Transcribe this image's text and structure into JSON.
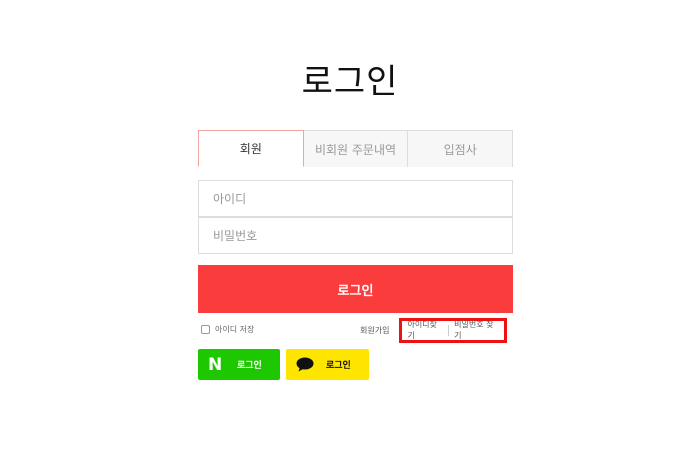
{
  "page": {
    "title": "로그인"
  },
  "tabs": [
    {
      "label": "회원",
      "active": true
    },
    {
      "label": "비회원 주문내역",
      "active": false
    },
    {
      "label": "입점사",
      "active": false
    }
  ],
  "form": {
    "id_placeholder": "아이디",
    "pw_placeholder": "비밀번호",
    "login_label": "로그인"
  },
  "options": {
    "save_id_label": "아이디 저장",
    "join_label": "회원가입",
    "find_id_label": "아이디찾기",
    "find_pw_label": "비밀번호 찾기"
  },
  "social": {
    "naver": {
      "logo": "N",
      "label": "로그인",
      "color": "#1ec800"
    },
    "kakao": {
      "icon": "speech-bubble-icon",
      "label": "로그인",
      "color": "#fee500"
    }
  },
  "colors": {
    "accent": "#fb3c3c",
    "highlight_box": "#ee1111"
  }
}
